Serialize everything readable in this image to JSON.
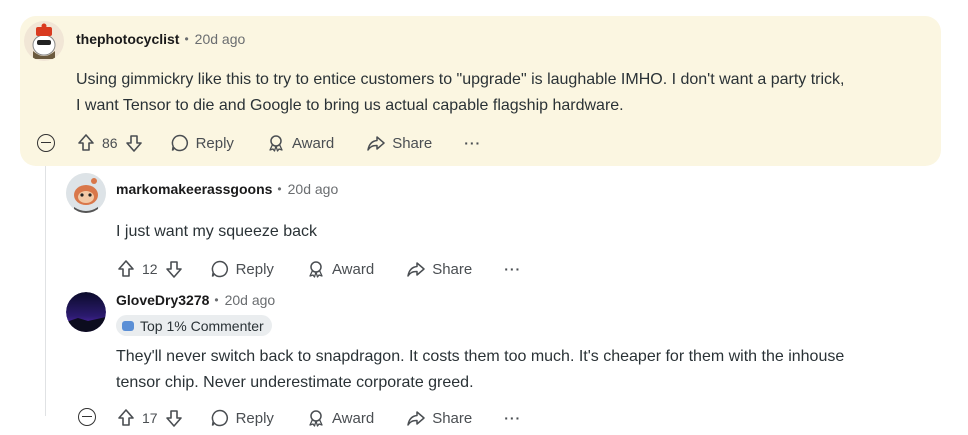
{
  "comments": [
    {
      "author": "thephotocyclist",
      "time": "20d ago",
      "lines": [
        "Using gimmickry like this to try to entice customers to \"upgrade\" is laughable IMHO. I don't want a party trick,",
        "I want Tensor to die and Google to bring us actual capable flagship hardware."
      ],
      "votes": "86"
    },
    {
      "author": "markomakeerassgoons",
      "time": "20d ago",
      "lines": [
        "I just want my squeeze back"
      ],
      "votes": "12"
    },
    {
      "author": "GloveDry3278",
      "time": "20d ago",
      "badge": "Top 1% Commenter",
      "lines": [
        "They'll never switch back to snapdragon. It costs them too much. It's cheaper for them with the inhouse",
        "tensor chip. Never underestimate corporate greed."
      ],
      "votes": "17"
    }
  ],
  "actions": {
    "reply": "Reply",
    "award": "Award",
    "share": "Share",
    "more": "···"
  },
  "separator": "•",
  "colors": {
    "highlight_bg": "#fbf6e1",
    "muted": "#6a6d70"
  }
}
